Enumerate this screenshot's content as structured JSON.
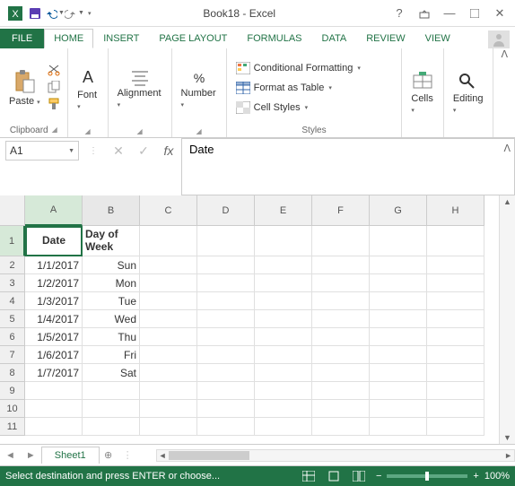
{
  "title": "Book18 - Excel",
  "tabs": {
    "file": "FILE",
    "home": "HOME",
    "insert": "INSERT",
    "pagelayout": "PAGE LAYOUT",
    "formulas": "FORMULAS",
    "data": "DATA",
    "review": "REVIEW",
    "view": "VIEW"
  },
  "ribbon": {
    "clipboard": "Clipboard",
    "paste": "Paste",
    "font": "Font",
    "alignment": "Alignment",
    "number": "Number",
    "cond": "Conditional Formatting",
    "table": "Format as Table",
    "styles_btn": "Cell Styles",
    "styles": "Styles",
    "cells": "Cells",
    "editing": "Editing"
  },
  "namebox": "A1",
  "formula": "Date",
  "columns": [
    "A",
    "B",
    "C",
    "D",
    "E",
    "F",
    "G",
    "H"
  ],
  "rows": [
    "1",
    "2",
    "3",
    "4",
    "5",
    "6",
    "7",
    "8",
    "9",
    "10",
    "11"
  ],
  "headers": {
    "A": "Date",
    "B": "Day of Week"
  },
  "data": [
    {
      "A": "1/1/2017",
      "B": "Sun"
    },
    {
      "A": "1/2/2017",
      "B": "Mon"
    },
    {
      "A": "1/3/2017",
      "B": "Tue"
    },
    {
      "A": "1/4/2017",
      "B": "Wed"
    },
    {
      "A": "1/5/2017",
      "B": "Thu"
    },
    {
      "A": "1/6/2017",
      "B": "Fri"
    },
    {
      "A": "1/7/2017",
      "B": "Sat"
    }
  ],
  "sheet_tab": "Sheet1",
  "status": "Select destination and press ENTER or choose...",
  "zoom": "100%"
}
